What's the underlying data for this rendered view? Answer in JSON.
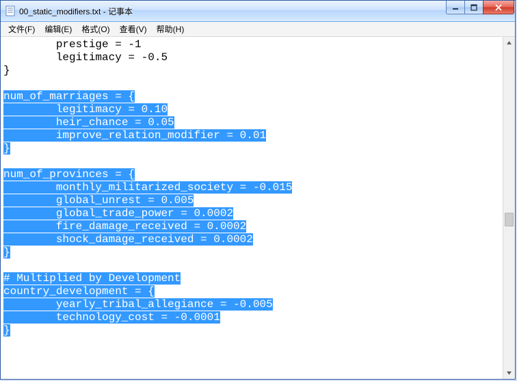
{
  "window": {
    "title": "00_static_modifiers.txt - 记事本"
  },
  "menu": {
    "file": "文件(F)",
    "edit": "编辑(E)",
    "format": "格式(O)",
    "view": "查看(V)",
    "help": "帮助(H)"
  },
  "code": {
    "l01": "        prestige = -1",
    "l02": "        legitimacy = -0.5",
    "l03": "}",
    "l04": "",
    "l05": "num_of_marriages = {",
    "l06a": "        ",
    "l06b": "legitimacy = 0.10",
    "l07a": "        ",
    "l07b": "heir_chance = 0.05",
    "l08a": "        ",
    "l08b": "improve_relation_modifier = 0.01",
    "l09": "}",
    "l10": "",
    "l11": "num_of_provinces = {",
    "l12a": "        ",
    "l12b": "monthly_militarized_society = -0.015",
    "l13a": "        ",
    "l13b": "global_unrest = 0.005",
    "l14a": "        ",
    "l14b": "global_trade_power = 0.0002",
    "l15a": "        ",
    "l15b": "fire_damage_received = 0.0002",
    "l16a": "        ",
    "l16b": "shock_damage_received = 0.0002",
    "l17": "}",
    "l18": "",
    "l19": "# Multiplied by Development",
    "l20": "country_development = {",
    "l21a": "        ",
    "l21b": "yearly_tribal_allegiance = -0.005",
    "l22a": "        ",
    "l22b": "technology_cost = -0.0001",
    "l23": "}"
  }
}
